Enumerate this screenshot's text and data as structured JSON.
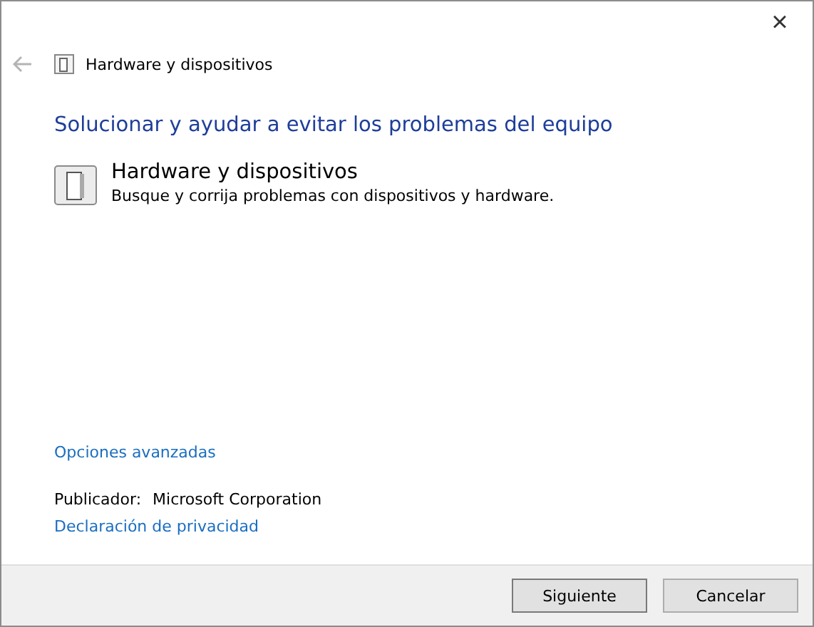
{
  "window": {
    "close": "×"
  },
  "nav": {
    "title": "Hardware y dispositivos"
  },
  "heading": "Solucionar y ayudar a evitar los problemas del equipo",
  "troubleshooter": {
    "title": "Hardware y dispositivos",
    "description": "Busque y corrija problemas con dispositivos y hardware."
  },
  "advanced_link": "Opciones avanzadas",
  "publisher": {
    "label": "Publicador:",
    "value": "Microsoft Corporation"
  },
  "privacy_link": "Declaración de privacidad",
  "buttons": [
    {
      "label": "Siguiente",
      "default": true
    },
    {
      "label": "Cancelar",
      "default": false
    }
  ]
}
